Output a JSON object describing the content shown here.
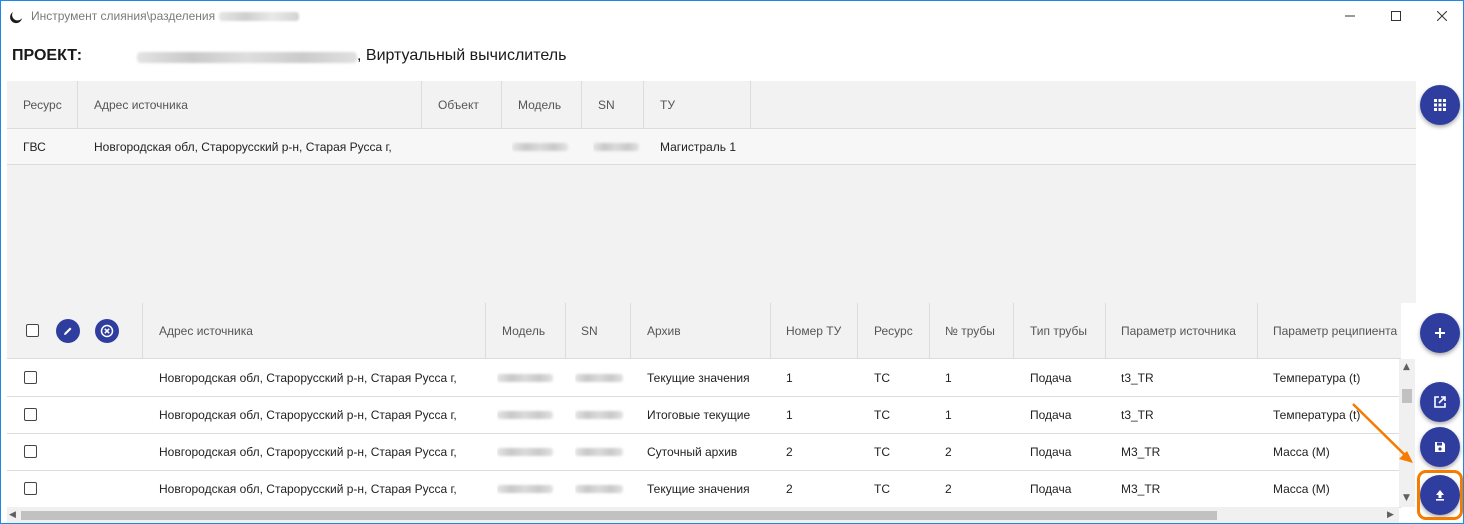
{
  "window": {
    "title": "Инструмент слияния\\разделения"
  },
  "project": {
    "label": "ПРОЕКТ:",
    "name": ", Виртуальный вычислитель"
  },
  "top_table": {
    "headers": [
      "Ресурс",
      "Адрес источника",
      "Объект",
      "Модель",
      "SN",
      "ТУ"
    ],
    "rows": [
      {
        "resource": "ГВС",
        "address": "Новгородская обл, Старорусский р-н, Старая Русса г,",
        "object": "",
        "tu": "Магистраль 1"
      }
    ]
  },
  "bottom_table": {
    "headers": [
      "Адрес источника",
      "Модель",
      "SN",
      "Архив",
      "Номер ТУ",
      "Ресурс",
      "№ трубы",
      "Тип трубы",
      "Параметр источника",
      "Параметр реципиента"
    ],
    "rows": [
      {
        "address": "Новгородская обл, Старорусский р-н, Старая Русса г,",
        "archive": "Текущие значения",
        "tu_number": "1",
        "resource": "ТС",
        "pipe_no": "1",
        "pipe_type": "Подача",
        "source_param": "t3_TR",
        "recipient_param": "Температура (t)"
      },
      {
        "address": "Новгородская обл, Старорусский р-н, Старая Русса г,",
        "archive": "Итоговые текущие",
        "tu_number": "1",
        "resource": "ТС",
        "pipe_no": "1",
        "pipe_type": "Подача",
        "source_param": "t3_TR",
        "recipient_param": "Температура (t)"
      },
      {
        "address": "Новгородская обл, Старорусский р-н, Старая Русса г,",
        "archive": "Суточный архив",
        "tu_number": "2",
        "resource": "ТС",
        "pipe_no": "2",
        "pipe_type": "Подача",
        "source_param": "M3_TR",
        "recipient_param": "Масса (M)"
      },
      {
        "address": "Новгородская обл, Старорусский р-н, Старая Русса г,",
        "archive": "Текущие значения",
        "tu_number": "2",
        "resource": "ТС",
        "pipe_no": "2",
        "pipe_type": "Подача",
        "source_param": "M3_TR",
        "recipient_param": "Масса (M)"
      }
    ]
  },
  "side_buttons": [
    "grid-icon",
    "add-icon",
    "open-external-icon",
    "save-icon",
    "upload-icon"
  ],
  "colors": {
    "accent": "#2f3e9e",
    "highlight": "#f57c00",
    "window_border": "#1e88e5"
  }
}
